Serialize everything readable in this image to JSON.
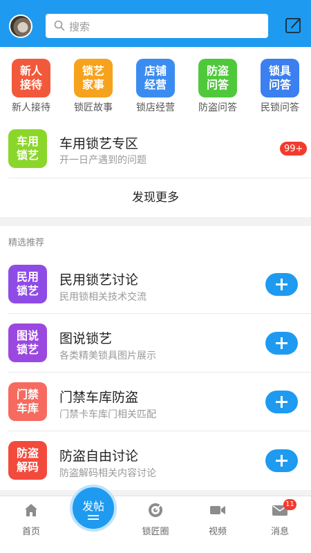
{
  "search": {
    "placeholder": "搜索"
  },
  "quick_links": [
    {
      "icon_text": "新人\n接待",
      "label": "新人接待",
      "color": "#f2593a"
    },
    {
      "icon_text": "锁艺\n家事",
      "label": "锁匠故事",
      "color": "#f7a21c"
    },
    {
      "icon_text": "店铺\n经营",
      "label": "锁店经营",
      "color": "#3b8cf0"
    },
    {
      "icon_text": "防盗\n问答",
      "label": "防盗问答",
      "color": "#4fc93b"
    },
    {
      "icon_text": "锁具\n问答",
      "label": "民锁问答",
      "color": "#3b7ff0"
    }
  ],
  "featured": {
    "icon_text": "车用\n锁艺",
    "title": "车用锁艺专区",
    "subtitle": "开一日产遇到的问题",
    "badge": "99+"
  },
  "discover_more": "发现更多",
  "section_title": "精选推荐",
  "forums": [
    {
      "icon_text": "民用\n锁艺",
      "title": "民用锁艺讨论",
      "subtitle": "民用锁相关技术交流",
      "color": "#8e4be6"
    },
    {
      "icon_text": "图说\n锁艺",
      "title": "图说锁艺",
      "subtitle": "各类精美锁具图片展示",
      "color": "#9b48e0"
    },
    {
      "icon_text": "门禁\n车库",
      "title": "门禁车库防盗",
      "subtitle": "门禁卡车库门相关匹配",
      "color": "#f66a5f"
    },
    {
      "icon_text": "防盗\n解码",
      "title": "防盗自由讨论",
      "subtitle": "防盗解码相关内容讨论",
      "color": "#f24a3c"
    }
  ],
  "tabbar": {
    "home": "首页",
    "post_main": "发帖",
    "circle": "锁匠圈",
    "video": "视频",
    "messages": "消息",
    "messages_badge": "11"
  },
  "colors": {
    "accent": "#1e9bf0",
    "badge": "#f23b2e"
  }
}
